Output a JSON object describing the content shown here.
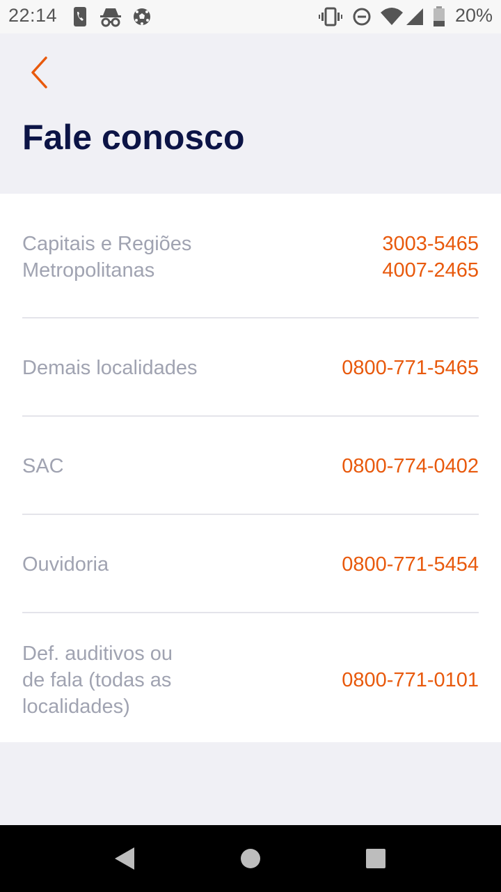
{
  "status_bar": {
    "time": "22:14",
    "battery_text": "20%",
    "icons": [
      "phone-icon",
      "incognito-icon",
      "soccer-ball-icon",
      "vibrate-icon",
      "do-not-disturb-icon",
      "wifi-icon",
      "signal-icon",
      "battery-icon"
    ]
  },
  "header": {
    "back_icon": "chevron-left-icon",
    "title": "Fale conosco"
  },
  "contacts": [
    {
      "label_lines": [
        "Capitais e Regiões",
        "Metropolitanas"
      ],
      "phones": [
        "3003-5465",
        "4007-2465"
      ]
    },
    {
      "label_lines": [
        "Demais localidades"
      ],
      "phones": [
        "0800-771-5465"
      ]
    },
    {
      "label_lines": [
        "SAC"
      ],
      "phones": [
        "0800-774-0402"
      ]
    },
    {
      "label_lines": [
        "Ouvidoria"
      ],
      "phones": [
        "0800-771-5454"
      ]
    },
    {
      "label_lines": [
        "Def. auditivos ou",
        "de fala (todas as",
        "localidades)"
      ],
      "phones": [
        "0800-771-0101"
      ]
    }
  ],
  "colors": {
    "accent": "#e8590c",
    "title": "#0c1446",
    "label": "#a0a3b1",
    "background": "#f0f0f5"
  },
  "nav_bar": {
    "buttons": [
      "back-triangle-icon",
      "home-circle-icon",
      "recents-square-icon"
    ]
  }
}
